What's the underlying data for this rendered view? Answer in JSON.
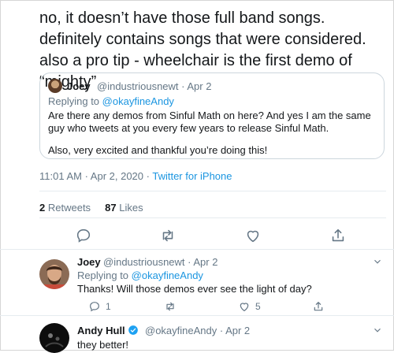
{
  "tweet": {
    "text": "no, it doesn’t have those full band songs. definitely contains songs that were considered. also a pro tip - wheelchair is the first demo of “mighty”",
    "timestamp": "11:01 AM · Apr 2, 2020",
    "source": "Twitter for iPhone",
    "retweets": "2",
    "retweets_label": "Retweets",
    "likes": "87",
    "likes_label": "Likes",
    "separator": " · "
  },
  "quoted": {
    "name": "Joey",
    "handle": "@industriousnewt · Apr 2",
    "replying_label": "Replying to",
    "replying_to": "@okayfineAndy",
    "paragraph1": "Are there any demos from Sinful Math on here? And yes I am the same guy who tweets at you every few years to release Sinful Math.",
    "paragraph2": "Also, very excited and thankful you’re doing this!"
  },
  "replies": [
    {
      "name": "Joey",
      "handle": "@industriousnewt · Apr 2",
      "replying_label": "Replying to",
      "replying_to": "@okayfineAndy",
      "text": "Thanks! Will those demos ever see the light of day?",
      "reply_count": "1",
      "like_count": "5"
    },
    {
      "name": "Andy Hull",
      "handle": "@okayfineAndy · Apr 2",
      "text": "they better!"
    }
  ],
  "icons": {
    "reply": "reply-icon",
    "retweet": "retweet-icon",
    "like": "heart-icon",
    "share": "share-icon",
    "more": "chevron-down-icon",
    "verified": "verified-badge-icon"
  },
  "colors": {
    "link": "#1b95e0",
    "secondary": "#657786",
    "text": "#14171a",
    "icon": "#657786",
    "verified": "#1da1f2"
  }
}
